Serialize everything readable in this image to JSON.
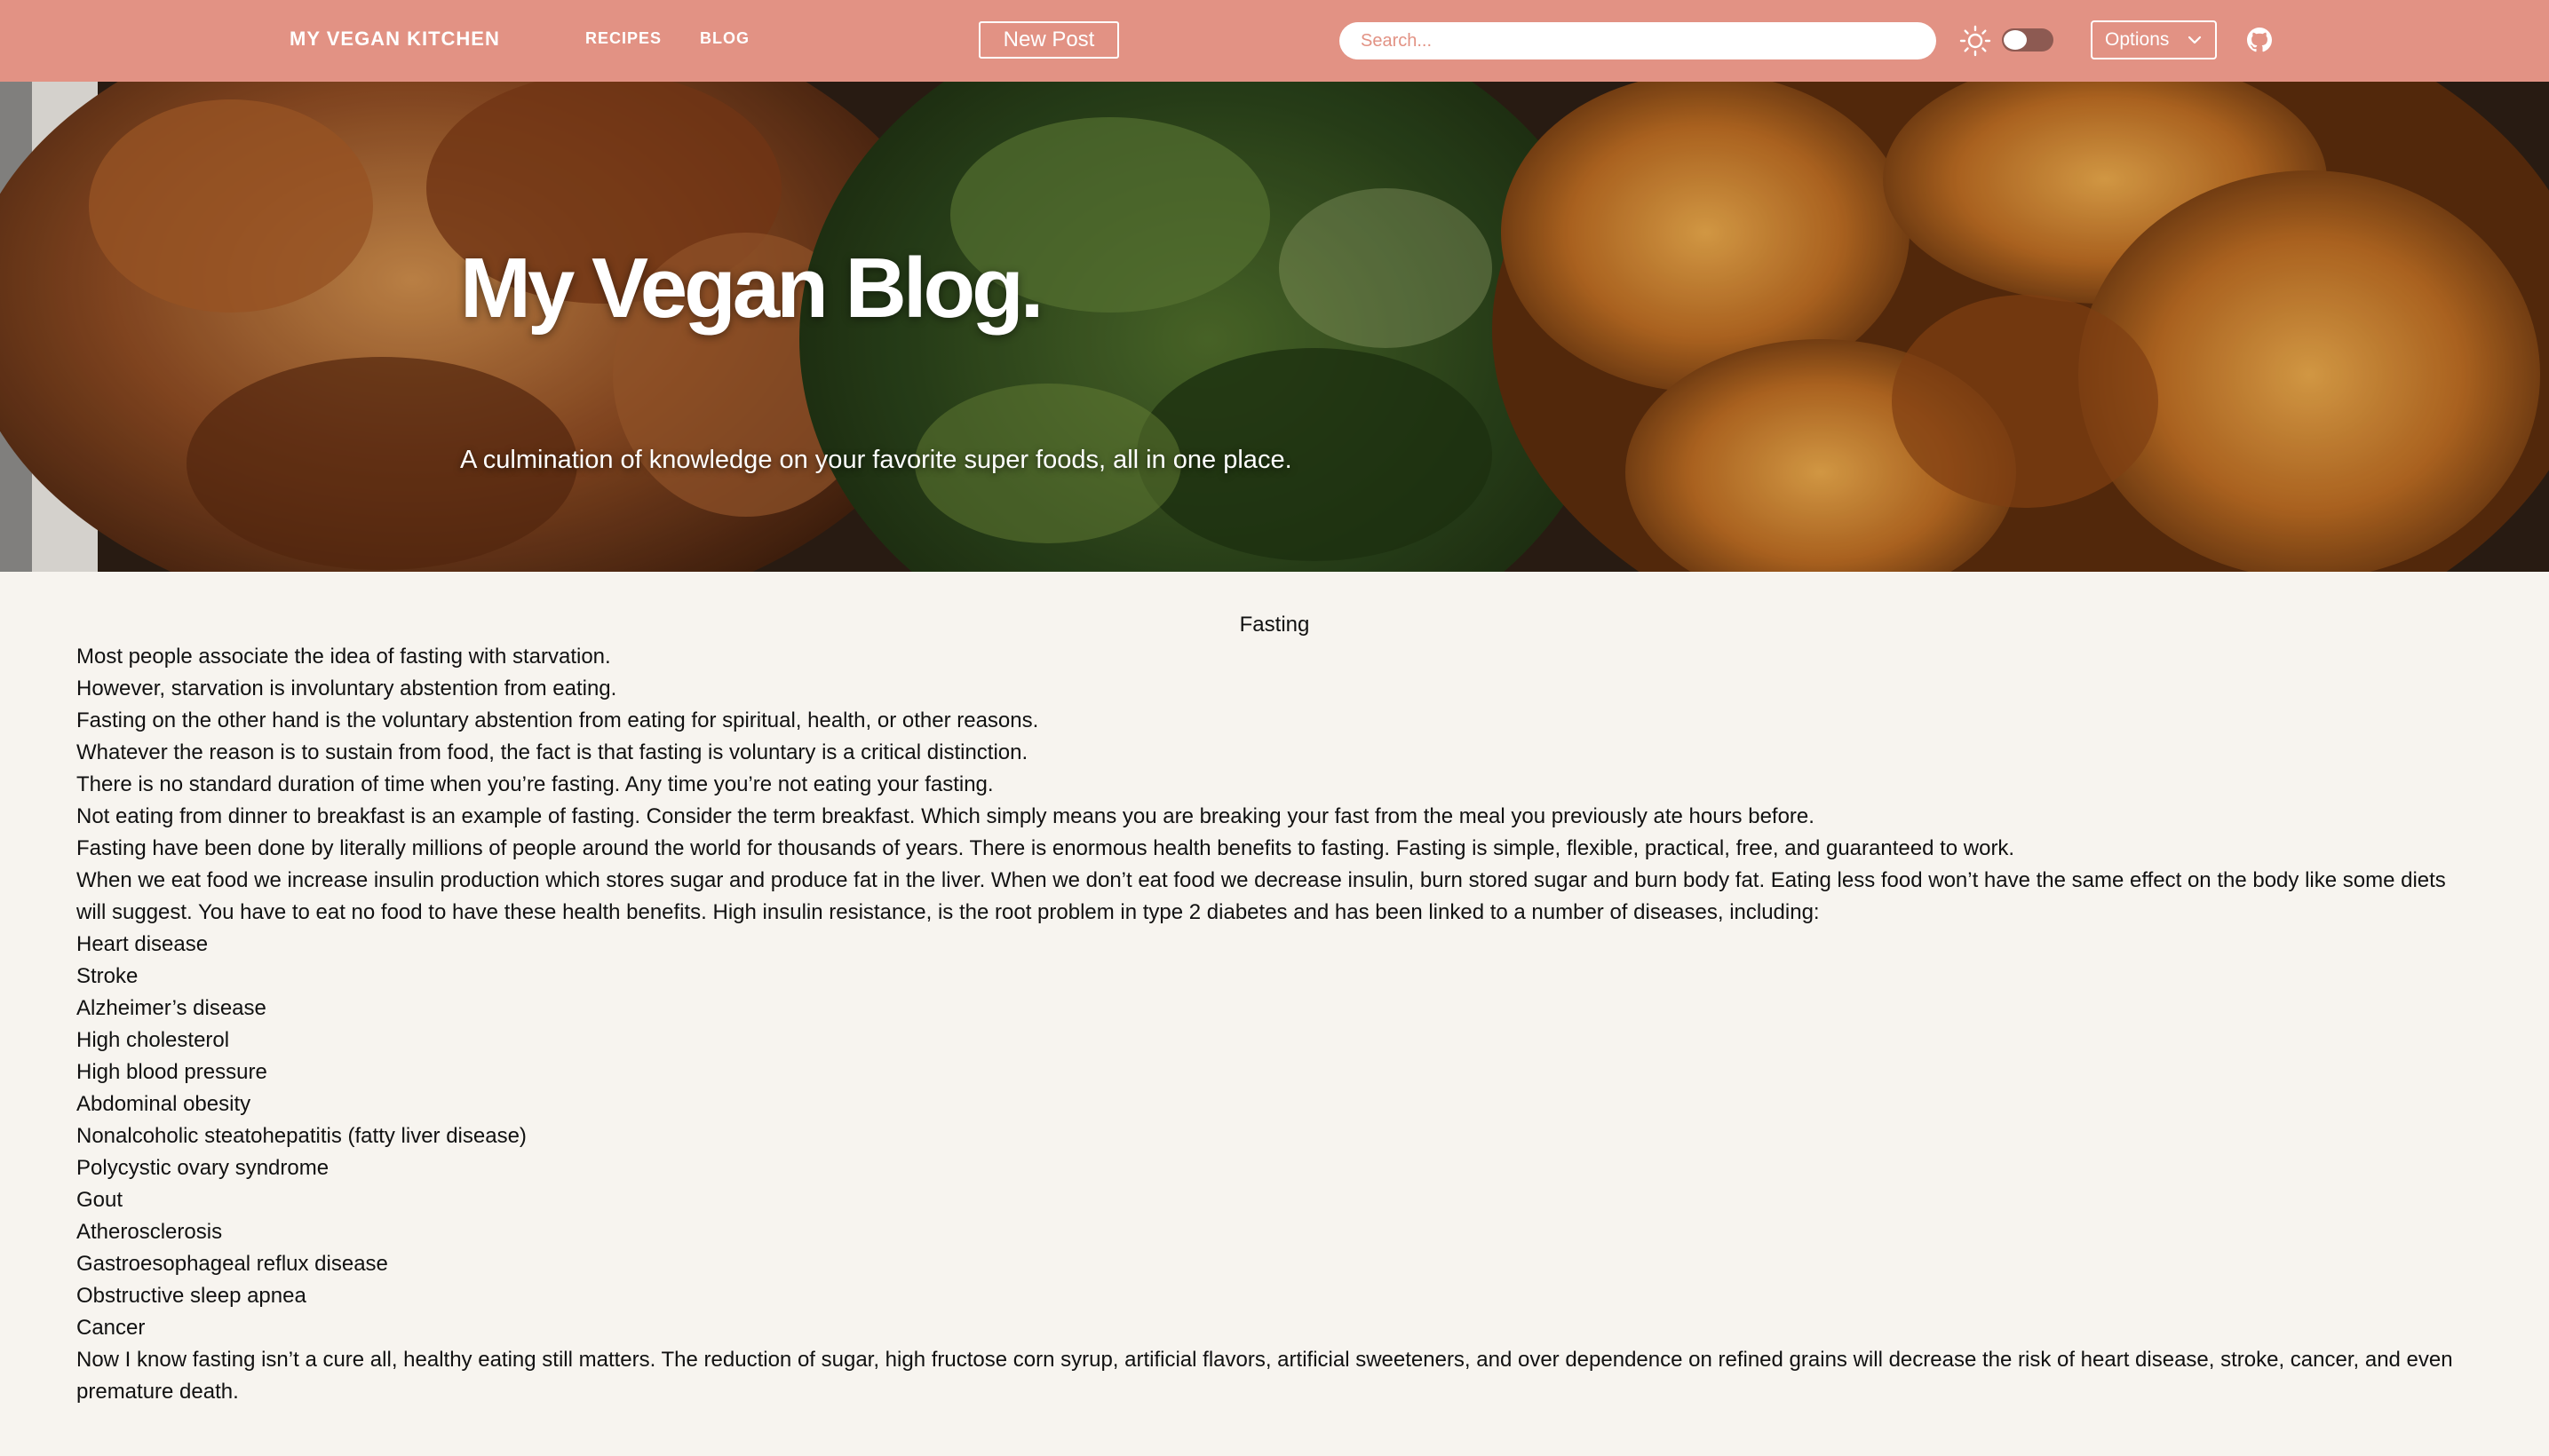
{
  "navbar": {
    "brand": "MY VEGAN KITCHEN",
    "links": [
      "RECIPES",
      "BLOG"
    ],
    "new_post_label": "New Post",
    "search_placeholder": "Search...",
    "options_label": "Options",
    "theme_toggle_on": false
  },
  "hero": {
    "title": "My Vegan Blog.",
    "subtitle": "A culmination of knowledge on your favorite super foods, all in one place."
  },
  "post": {
    "title": "Fasting",
    "paragraphs": [
      "Most people associate the idea of fasting with starvation.",
      "However, starvation is involuntary abstention from eating.",
      "Fasting on the other hand is the voluntary abstention from eating for spiritual, health, or other reasons.",
      "Whatever the reason is to sustain from food, the fact is that fasting is voluntary is a critical distinction.",
      "There is no standard duration of time when you’re fasting. Any time you’re not eating your fasting.",
      "Not eating from dinner to breakfast is an example of fasting. Consider the term breakfast. Which simply means you are breaking your fast from the meal you previously ate hours before.",
      "Fasting have been done by literally millions of people around the world for thousands of years. There is enormous health benefits to fasting. Fasting is simple, flexible, practical, free, and guaranteed to work.",
      "When we eat food we increase insulin production which stores sugar and produce fat in the liver. When we don’t eat food we decrease insulin, burn stored sugar and burn body fat. Eating less food won’t have the same effect on the body like some diets will suggest. You have to eat no food to have these health benefits. High insulin resistance, is the root problem in type 2 diabetes and has been linked to a number of diseases, including:",
      "Heart disease",
      "Stroke",
      "Alzheimer’s disease",
      "High cholesterol",
      "High blood pressure",
      "Abdominal obesity",
      "Nonalcoholic steatohepatitis (fatty liver disease)",
      "Polycystic ovary syndrome",
      "Gout",
      "Atherosclerosis",
      "Gastroesophageal reflux disease",
      "Obstructive sleep apnea",
      "Cancer",
      "Now I know fasting isn’t a cure all, healthy eating still matters. The reduction of sugar, high fructose corn syrup, artificial flavors, artificial sweeteners, and over dependence on refined grains will decrease the risk of heart disease, stroke, cancer, and even premature death."
    ]
  },
  "colors": {
    "navbar_bg": "#e29284",
    "page_bg": "#f7f4ef",
    "toggle_track": "#8d5a52"
  }
}
